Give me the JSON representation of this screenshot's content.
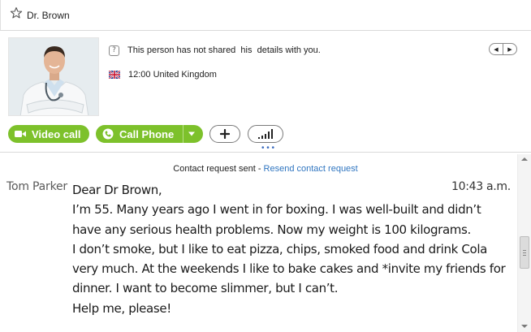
{
  "header": {
    "contact_name": "Dr. Brown",
    "star_icon": "star-icon"
  },
  "profile": {
    "photo_icon": "doctor-photo",
    "status_icon": "question-icon",
    "status_text": "This person has not shared  his  details with you.",
    "flag_icon": "uk-flag-icon",
    "local_time_text": "12:00 United Kingdom"
  },
  "actions": {
    "video_call_label": "Video call",
    "call_phone_label": "Call Phone",
    "accent_color": "#7dc12b"
  },
  "conversation": {
    "request_text": "Contact request sent - ",
    "resend_link": "Resend contact request",
    "message": {
      "sender": "Tom Parker",
      "time": "10:43 a.m.",
      "lines": [
        "Dear Dr Brown,",
        "I’m 55. Many years ago I went in for boxing. I was well-built and didn’t",
        "have any serious health problems. Now my weight is 100 kilograms.",
        "I don’t smoke, but I like to eat pizza, chips, smoked food and drink Cola",
        "very much. At the weekends I like to bake cakes and *invite my friends for",
        "dinner. I want to become slimmer, but I can’t.",
        "Help me, please!"
      ]
    }
  }
}
